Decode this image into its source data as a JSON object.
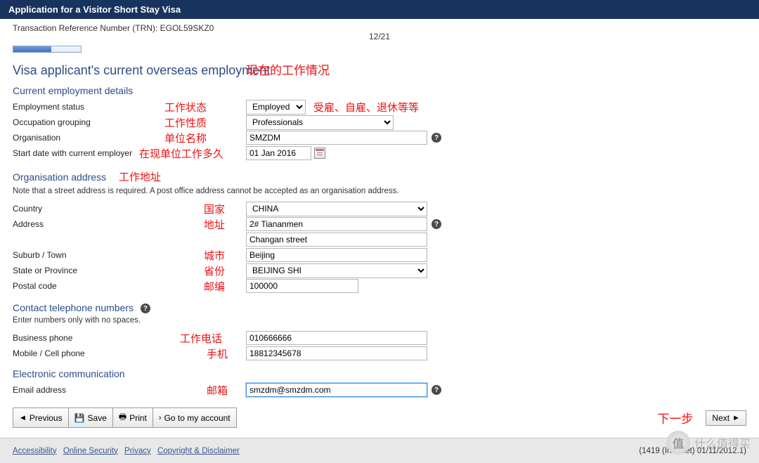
{
  "title_bar": "Application for a Visitor Short Stay Visa",
  "trn_label": "Transaction Reference Number (TRN): EGOL59SKZ0",
  "page_indicator": "12/21",
  "section_title": "Visa applicant's current overseas employment",
  "anno_section": "现在的工作情况",
  "sub1": "Current employment details",
  "row_emp_status": {
    "label": "Employment status",
    "value": "Employed",
    "anno_left": "工作状态",
    "anno_right": "受雇、自雇、退休等等"
  },
  "row_occ_group": {
    "label": "Occupation grouping",
    "value": "Professionals",
    "anno_left": "工作性质"
  },
  "row_org": {
    "label": "Organisation",
    "value": "SMZDM",
    "anno_left": "单位名称"
  },
  "row_start": {
    "label": "Start date with current employer",
    "value": "01 Jan 2016",
    "anno_left": "在现单位工作多久"
  },
  "sub2": "Organisation address",
  "anno_sub2": "工作地址",
  "hint2": "Note that a street address is required. A post office address cannot be accepted as an organisation address.",
  "row_country": {
    "label": "Country",
    "value": "CHINA",
    "anno_left": "国家"
  },
  "row_addr": {
    "label": "Address",
    "value1": "2# Tiananmen",
    "value2": "Changan street",
    "anno_left": "地址"
  },
  "row_suburb": {
    "label": "Suburb / Town",
    "value": "Beijing",
    "anno_left": "城市"
  },
  "row_state": {
    "label": "State or Province",
    "value": "BEIJING SHI",
    "anno_left": "省份"
  },
  "row_postal": {
    "label": "Postal code",
    "value": "100000",
    "anno_left": "邮编"
  },
  "sub3": "Contact telephone numbers",
  "hint3": "Enter numbers only with no spaces.",
  "row_bphone": {
    "label": "Business phone",
    "value": "010666666",
    "anno_left": "工作电话"
  },
  "row_mphone": {
    "label": "Mobile / Cell phone",
    "value": "18812345678",
    "anno_left": "手机"
  },
  "sub4": "Electronic communication",
  "row_email": {
    "label": "Email address",
    "value": "smzdm@smzdm.com",
    "anno_left": "邮箱"
  },
  "buttons": {
    "previous": "Previous",
    "save": "Save",
    "print": "Print",
    "account": "Go to my account",
    "next": "Next"
  },
  "anno_next": "下一步",
  "footer_links": {
    "a1": "Accessibility",
    "a2": "Online Security",
    "a3": "Privacy",
    "a4": "Copyright & Disclaimer"
  },
  "footer_right": "(1419 (Internet) 01/11/2012.1)",
  "watermark": "什么值得买"
}
